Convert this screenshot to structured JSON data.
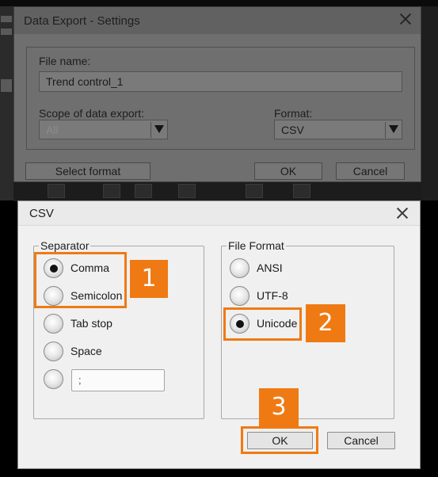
{
  "export_dialog": {
    "title": "Data Export - Settings",
    "file_name_label": "File name:",
    "file_name_value": "Trend control_1",
    "scope_label": "Scope of data export:",
    "scope_value": "All",
    "format_label": "Format:",
    "format_value": "CSV",
    "select_format_label": "Select format",
    "ok_label": "OK",
    "cancel_label": "Cancel"
  },
  "csv_dialog": {
    "title": "CSV",
    "separator_legend": "Separator",
    "separators": [
      {
        "label": "Comma",
        "checked": true
      },
      {
        "label": "Semicolon",
        "checked": false
      },
      {
        "label": "Tab stop",
        "checked": false
      },
      {
        "label": "Space",
        "checked": false
      }
    ],
    "custom_separator_value": ";",
    "file_format_legend": "File Format",
    "file_formats": [
      {
        "label": "ANSI",
        "checked": false
      },
      {
        "label": "UTF-8",
        "checked": false
      },
      {
        "label": "Unicode",
        "checked": true
      }
    ],
    "ok_label": "OK",
    "cancel_label": "Cancel"
  },
  "callouts": [
    "1",
    "2",
    "3"
  ],
  "colors": {
    "callout_orange": "#ef7a13",
    "dialog_bg": "#f0f0f0",
    "dimmed_bg": "#6f6f6f"
  }
}
